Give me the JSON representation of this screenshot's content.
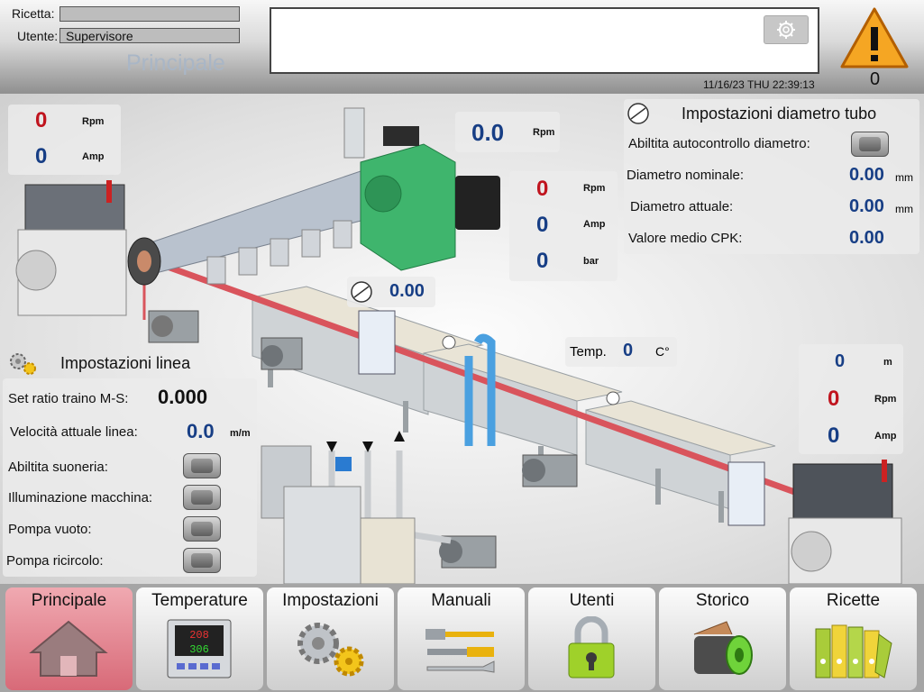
{
  "header": {
    "ricetta_label": "Ricetta:",
    "ricetta_value": "",
    "utente_label": "Utente:",
    "utente_value": "Supervisore",
    "page_title": "Principale",
    "datetime": "11/16/23 THU 22:39:13",
    "alarm_count": "0"
  },
  "extruder_left": {
    "rpm_value": "0",
    "rpm_unit": "Rpm",
    "amp_value": "0",
    "amp_unit": "Amp"
  },
  "extruder_top": {
    "rpm_value": "0.0",
    "rpm_unit": "Rpm"
  },
  "extruder_motor": {
    "rpm_value": "0",
    "rpm_unit": "Rpm",
    "amp_value": "0",
    "amp_unit": "Amp",
    "bar_value": "0",
    "bar_unit": "bar"
  },
  "diameter": {
    "title": "Impostazioni diametro tubo",
    "auto_label": "Abiltita autocontrollo diametro:",
    "nominal_label": "Diametro nominale:",
    "nominal_value": "0.00",
    "nominal_unit": "mm",
    "actual_label": "Diametro attuale:",
    "actual_value": "0.00",
    "actual_unit": "mm",
    "cpk_label": "Valore medio CPK:",
    "cpk_value": "0.00"
  },
  "gauge_value": "0.00",
  "temp": {
    "label": "Temp.",
    "value": "0",
    "unit": "C°"
  },
  "puller_right": {
    "m_value": "0",
    "m_unit": "m",
    "rpm_value": "0",
    "rpm_unit": "Rpm",
    "amp_value": "0",
    "amp_unit": "Amp"
  },
  "line": {
    "title": "Impostazioni linea",
    "ratio_label": "Set ratio traino M-S:",
    "ratio_value": "0.000",
    "speed_label": "Velocità attuale linea:",
    "speed_value": "0.0",
    "speed_unit": "m/m",
    "buzzer_label": "Abiltita suoneria:",
    "light_label": "Illuminazione macchina:",
    "vacuum_label": "Pompa vuoto:",
    "recirc_label": "Pompa ricircolo:"
  },
  "nav": [
    {
      "label": "Principale",
      "icon": "home-icon",
      "active": true
    },
    {
      "label": "Temperature",
      "icon": "temperature-controller-icon",
      "active": false
    },
    {
      "label": "Impostazioni",
      "icon": "gears-icon",
      "active": false
    },
    {
      "label": "Manuali",
      "icon": "tools-icon",
      "active": false
    },
    {
      "label": "Utenti",
      "icon": "padlock-icon",
      "active": false
    },
    {
      "label": "Storico",
      "icon": "film-roll-icon",
      "active": false
    },
    {
      "label": "Ricette",
      "icon": "binders-icon",
      "active": false
    }
  ],
  "colors": {
    "active_tab": "#d86a78",
    "value_red": "#c0141e",
    "value_blue": "#173e85",
    "pipe": "#d9545c",
    "motor_green": "#3fb56d"
  }
}
